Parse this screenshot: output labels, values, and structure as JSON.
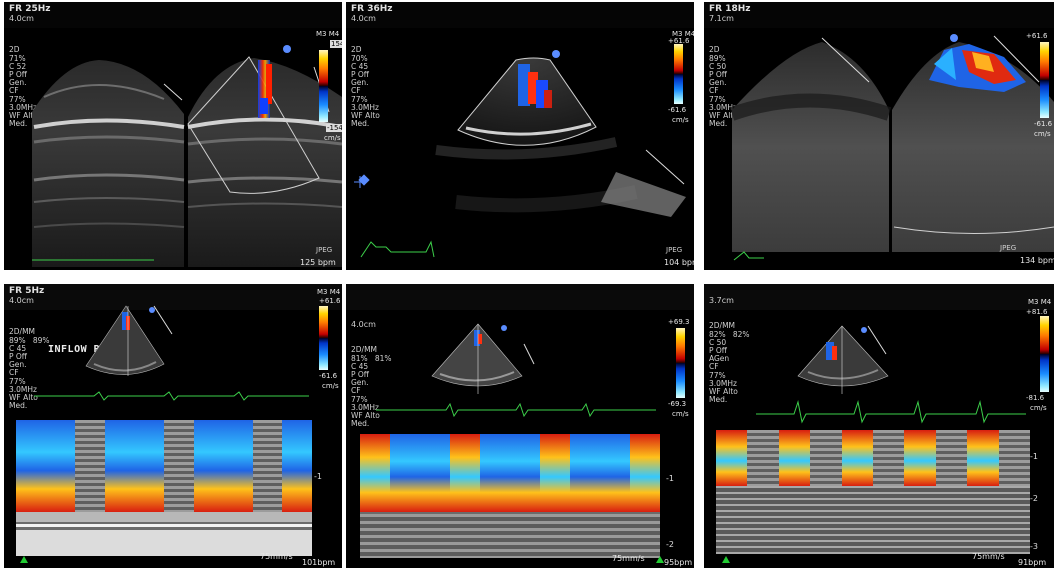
{
  "panels": [
    {
      "fr": "FR 25Hz",
      "depth": "4.0cm",
      "lines": [
        "2D",
        "71%",
        "C 52",
        "P Off",
        "Gen.",
        "",
        "CF",
        "77%",
        "3.0MHz",
        "WF Alto",
        "Med."
      ],
      "scale_top": "154",
      "scale_bottom": "-154",
      "scale_mode": "M3 M4",
      "unit": "cm/s",
      "format": "JPEG",
      "heart_rate": "125 bpm"
    },
    {
      "fr": "FR 36Hz",
      "depth": "4.0cm",
      "lines": [
        "2D",
        "70%",
        "C 45",
        "P Off",
        "Gen.",
        "",
        "CF",
        "77%",
        "3.0MHz",
        "WF Alto",
        "Med."
      ],
      "scale_top": "+61.6",
      "scale_bottom": "-61.6",
      "scale_mode": "M3 M4",
      "unit": "cm/s",
      "format": "JPEG",
      "heart_rate": "104 bpm"
    },
    {
      "fr": "FR 18Hz",
      "depth": "7.1cm",
      "lines": [
        "2D",
        "89%",
        "C 50",
        "P Off",
        "Gen.",
        "",
        "CF",
        "77%",
        "3.0MHz",
        "WF Alto",
        "Med."
      ],
      "scale_top": "+61.6",
      "scale_bottom": "-61.6",
      "scale_mode": "M3 M4",
      "unit": "cm/s",
      "format": "JPEG",
      "heart_rate": "134 bpm"
    },
    {
      "fr": "FR 5Hz",
      "depth": "4.0cm",
      "lines": [
        "2D/MM",
        "89%   89%",
        "C 45",
        "P Off",
        "Gen.",
        "",
        "CF",
        "77%",
        "3.0MHz",
        "WF Alto",
        "Med."
      ],
      "scale_top": "+61.6",
      "scale_bottom": "-61.6",
      "scale_mode": "M3 M4",
      "unit": "cm/s",
      "annotation": "INFLOW RVAD",
      "sweep": "75mm/s",
      "heart_rate": "101bpm",
      "depth_ticks": [
        "-1"
      ]
    },
    {
      "fr": "",
      "depth": "4.0cm",
      "lines": [
        "2D/MM",
        "81%   81%",
        "C 45",
        "P Off",
        "Gen.",
        "",
        "CF",
        "77%",
        "3.0MHz",
        "WF Alto",
        "Med."
      ],
      "scale_top": "+69.3",
      "scale_bottom": "-69.3",
      "scale_mode": "",
      "unit": "cm/s",
      "sweep": "75mm/s",
      "heart_rate": "95bpm",
      "depth_ticks": [
        "-1",
        "-2"
      ]
    },
    {
      "fr": "",
      "depth": "3.7cm",
      "lines": [
        "2D/MM",
        "82%   82%",
        "C 50",
        "P Off",
        "AGen",
        "",
        "CF",
        "77%",
        "3.0MHz",
        "WF Alto",
        "Med."
      ],
      "scale_top": "+81.6",
      "scale_bottom": "-81.6",
      "scale_mode": "M3 M4",
      "unit": "cm/s",
      "sweep": "75mm/s",
      "heart_rate": "91bpm",
      "depth_ticks": [
        "-1",
        "-2",
        "-3"
      ]
    }
  ],
  "colors": {
    "ecg": "#3ccf4a",
    "flow_red": "#d81e10",
    "flow_yellow": "#ffc21a",
    "flow_blue": "#1f64e6",
    "flow_cyan": "#34c8ff"
  },
  "mmode": [
    {
      "pattern": [
        "blue",
        "blue",
        "gray",
        "blue",
        "blue",
        "gray",
        "blue",
        "blue",
        "gray",
        "blue"
      ]
    },
    {
      "pattern": [
        "mosaic",
        "blue",
        "blue",
        "mosaic",
        "blue",
        "blue",
        "mosaic",
        "blue",
        "blue",
        "mosaic"
      ]
    },
    {
      "pattern": [
        "mosaic",
        "gray",
        "mosaic",
        "gray",
        "mosaic",
        "gray",
        "mosaic",
        "gray",
        "mosaic",
        "gray"
      ]
    }
  ]
}
